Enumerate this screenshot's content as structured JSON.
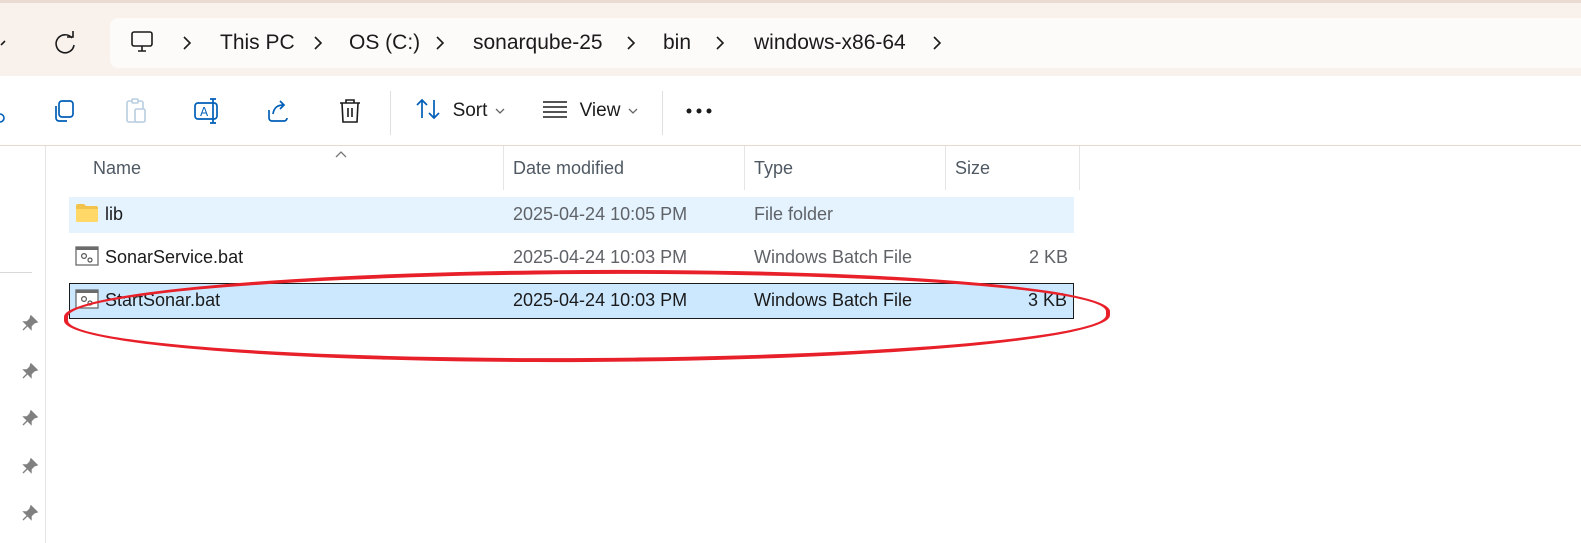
{
  "address_bar": {
    "breadcrumbs": [
      {
        "label": "This PC"
      },
      {
        "label": "OS (C:)"
      },
      {
        "label": "sonarqube-25"
      },
      {
        "label": "bin"
      },
      {
        "label": "windows-x86-64"
      }
    ]
  },
  "toolbar": {
    "sort_label": "Sort",
    "view_label": "View",
    "icons": [
      "cut-icon",
      "copy-icon",
      "paste-icon",
      "rename-icon",
      "share-icon",
      "delete-icon",
      "sort-icon",
      "view-icon",
      "more-icon"
    ]
  },
  "file_list": {
    "columns": [
      "Name",
      "Date modified",
      "Type",
      "Size"
    ],
    "rows": [
      {
        "name": "lib",
        "date": "2025-04-24 10:05 PM",
        "type": "File folder",
        "size": "",
        "icon": "folder-icon"
      },
      {
        "name": "SonarService.bat",
        "date": "2025-04-24 10:03 PM",
        "type": "Windows Batch File",
        "size": "2 KB",
        "icon": "batch-file-icon"
      },
      {
        "name": "StartSonar.bat",
        "date": "2025-04-24 10:03 PM",
        "type": "Windows Batch File",
        "size": "3 KB",
        "icon": "batch-file-icon"
      }
    ],
    "selected_row": "StartSonar.bat"
  },
  "colors": {
    "title_bg": "#f9f1ec",
    "hover_row": "#e5f3ff",
    "selected_row": "#cce8ff",
    "annotation": "#e8202a",
    "accent_icon": "#005fb8"
  }
}
